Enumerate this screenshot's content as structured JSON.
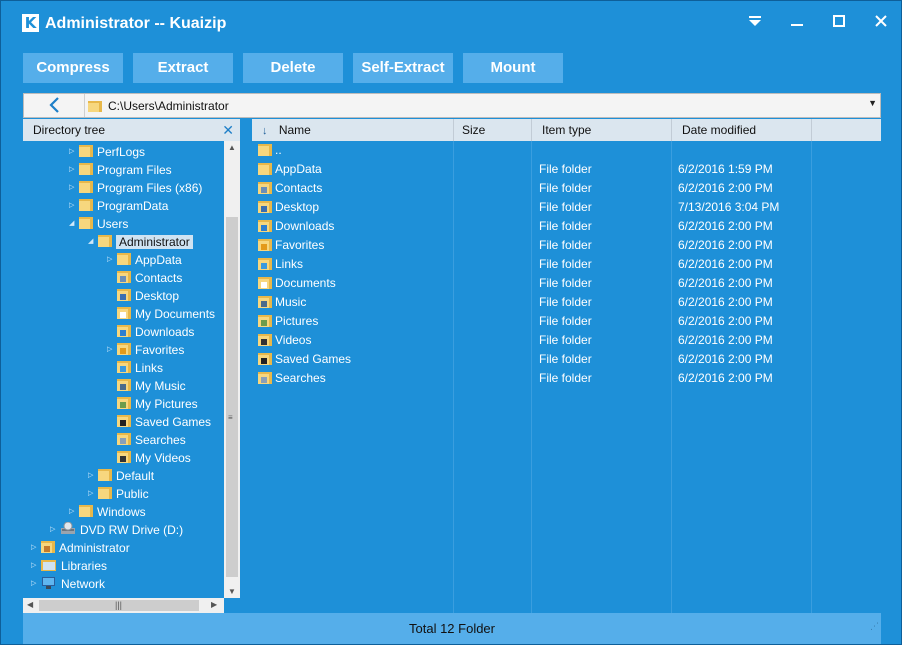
{
  "window": {
    "title": "Administrator -- Kuaizip",
    "logo": "K"
  },
  "toolbar": {
    "buttons": [
      "Compress",
      "Extract",
      "Delete",
      "Self-Extract",
      "Mount"
    ]
  },
  "address": {
    "path": "C:\\Users\\Administrator"
  },
  "tree": {
    "header": "Directory tree",
    "items": [
      {
        "label": "PerfLogs",
        "level": 2,
        "icon": "folder-icon",
        "exp": "▷"
      },
      {
        "label": "Program Files",
        "level": 2,
        "icon": "folder-icon",
        "exp": "▷"
      },
      {
        "label": "Program Files (x86)",
        "level": 2,
        "icon": "folder-icon",
        "exp": "▷"
      },
      {
        "label": "ProgramData",
        "level": 2,
        "icon": "folder-icon",
        "exp": "▷"
      },
      {
        "label": "Users",
        "level": 2,
        "icon": "folder-icon",
        "exp": "◢"
      },
      {
        "label": "Administrator",
        "level": 3,
        "icon": "folder-icon",
        "exp": "◢",
        "selected": true
      },
      {
        "label": "AppData",
        "level": 4,
        "icon": "folder-icon",
        "exp": "▷"
      },
      {
        "label": "Contacts",
        "level": 4,
        "icon": "contacts-folder-icon",
        "exp": ""
      },
      {
        "label": "Desktop",
        "level": 4,
        "icon": "desktop-folder-icon",
        "exp": ""
      },
      {
        "label": "My Documents",
        "level": 4,
        "icon": "documents-folder-icon",
        "exp": ""
      },
      {
        "label": "Downloads",
        "level": 4,
        "icon": "downloads-folder-icon",
        "exp": ""
      },
      {
        "label": "Favorites",
        "level": 4,
        "icon": "favorites-folder-icon",
        "exp": "▷"
      },
      {
        "label": "Links",
        "level": 4,
        "icon": "links-folder-icon",
        "exp": ""
      },
      {
        "label": "My Music",
        "level": 4,
        "icon": "music-folder-icon",
        "exp": ""
      },
      {
        "label": "My Pictures",
        "level": 4,
        "icon": "pictures-folder-icon",
        "exp": ""
      },
      {
        "label": "Saved Games",
        "level": 4,
        "icon": "saved-games-folder-icon",
        "exp": ""
      },
      {
        "label": "Searches",
        "level": 4,
        "icon": "searches-folder-icon",
        "exp": ""
      },
      {
        "label": "My Videos",
        "level": 4,
        "icon": "videos-folder-icon",
        "exp": ""
      },
      {
        "label": "Default",
        "level": 3,
        "icon": "folder-icon",
        "exp": "▷"
      },
      {
        "label": "Public",
        "level": 3,
        "icon": "folder-icon",
        "exp": "▷"
      },
      {
        "label": "Windows",
        "level": 2,
        "icon": "folder-icon",
        "exp": "▷"
      },
      {
        "label": "DVD RW Drive (D:)",
        "level": 1,
        "icon": "dvd-drive-icon",
        "exp": "▷"
      },
      {
        "label": "Administrator",
        "level": 0,
        "icon": "user-folder-icon",
        "exp": "▷"
      },
      {
        "label": "Libraries",
        "level": 0,
        "icon": "libraries-icon",
        "exp": "▷"
      },
      {
        "label": "Network",
        "level": 0,
        "icon": "network-icon",
        "exp": "▷"
      }
    ]
  },
  "list": {
    "columns": {
      "name": "Name",
      "size": "Size",
      "type": "Item type",
      "date": "Date modified"
    },
    "sort_arrow": "↓",
    "rows": [
      {
        "name": "..",
        "size": "",
        "type": "",
        "date": "",
        "icon": "parent-folder-icon"
      },
      {
        "name": "AppData",
        "size": "",
        "type": "File folder",
        "date": "6/2/2016 1:59 PM",
        "icon": "folder-icon"
      },
      {
        "name": "Contacts",
        "size": "",
        "type": "File folder",
        "date": "6/2/2016 2:00 PM",
        "icon": "contacts-folder-icon"
      },
      {
        "name": "Desktop",
        "size": "",
        "type": "File folder",
        "date": "7/13/2016 3:04 PM",
        "icon": "desktop-folder-icon"
      },
      {
        "name": "Downloads",
        "size": "",
        "type": "File folder",
        "date": "6/2/2016 2:00 PM",
        "icon": "downloads-folder-icon"
      },
      {
        "name": "Favorites",
        "size": "",
        "type": "File folder",
        "date": "6/2/2016 2:00 PM",
        "icon": "favorites-folder-icon"
      },
      {
        "name": "Links",
        "size": "",
        "type": "File folder",
        "date": "6/2/2016 2:00 PM",
        "icon": "links-folder-icon"
      },
      {
        "name": "Documents",
        "size": "",
        "type": "File folder",
        "date": "6/2/2016 2:00 PM",
        "icon": "documents-folder-icon"
      },
      {
        "name": "Music",
        "size": "",
        "type": "File folder",
        "date": "6/2/2016 2:00 PM",
        "icon": "music-folder-icon"
      },
      {
        "name": "Pictures",
        "size": "",
        "type": "File folder",
        "date": "6/2/2016 2:00 PM",
        "icon": "pictures-folder-icon"
      },
      {
        "name": "Videos",
        "size": "",
        "type": "File folder",
        "date": "6/2/2016 2:00 PM",
        "icon": "videos-folder-icon"
      },
      {
        "name": "Saved Games",
        "size": "",
        "type": "File folder",
        "date": "6/2/2016 2:00 PM",
        "icon": "saved-games-folder-icon"
      },
      {
        "name": "Searches",
        "size": "",
        "type": "File folder",
        "date": "6/2/2016 2:00 PM",
        "icon": "searches-folder-icon"
      }
    ]
  },
  "status": {
    "text": "Total 12 Folder"
  },
  "colors": {
    "background": "#1e90d8",
    "button": "#55aeea",
    "folder": "#f2c24f",
    "header": "#dbe6ef"
  }
}
